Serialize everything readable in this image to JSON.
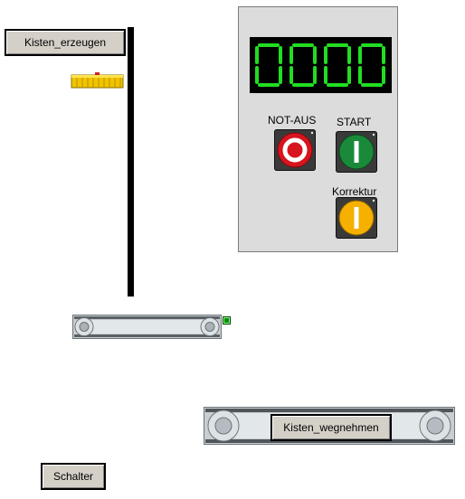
{
  "buttons": {
    "kisten_erzeugen": "Kisten_erzeugen",
    "kisten_wegnehmen": "Kisten_wegnehmen",
    "schalter": "Schalter"
  },
  "control_panel": {
    "counter_display": "0000",
    "display_color": "#22dd22",
    "labels": {
      "not_aus": "NOT-AUS",
      "start": "START",
      "korrektur": "Korrektur"
    },
    "button_colors": {
      "not_aus": "#d8141e",
      "start": "#1a8a3a",
      "korrektur": "#f5b000"
    }
  },
  "icons": {
    "crate": "crate-icon",
    "sensor": "sensor-icon"
  }
}
